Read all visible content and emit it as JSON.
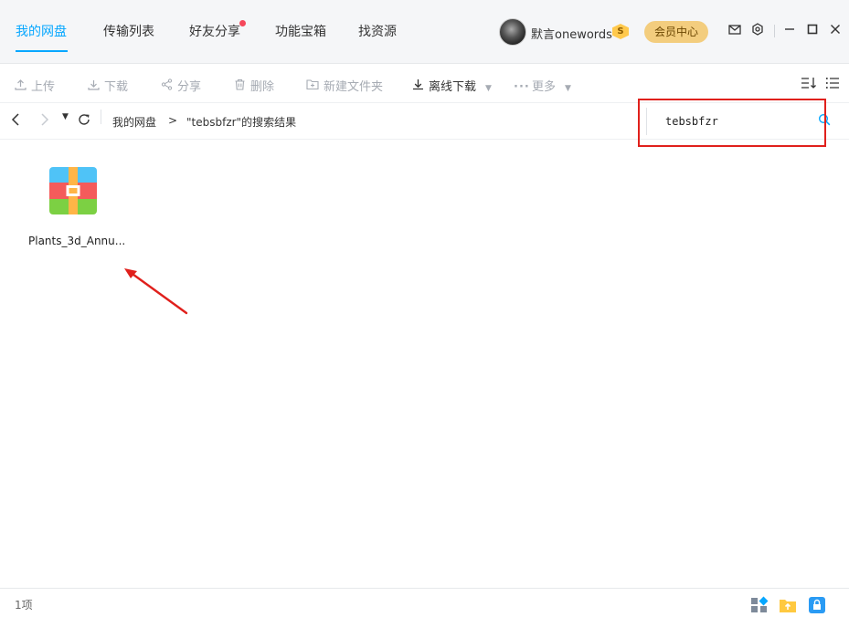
{
  "nav": {
    "tabs": [
      "我的网盘",
      "传输列表",
      "好友分享",
      "功能宝箱",
      "找资源"
    ],
    "active_index": 0,
    "user": {
      "name": "默言onewords",
      "badge": "S"
    },
    "vip_button": "会员中心"
  },
  "toolbar": {
    "upload": "上传",
    "download": "下载",
    "share": "分享",
    "delete": "删除",
    "new_folder": "新建文件夹",
    "offline_download": "离线下载",
    "more": "更多"
  },
  "address": {
    "crumb_root": "我的网盘",
    "crumb_sep": ">",
    "crumb_current": "\"tebsbfzr\"的搜索结果"
  },
  "search": {
    "value": "tebsbfzr"
  },
  "files": [
    {
      "name": "Plants_3d_Annu...",
      "type": "archive"
    }
  ],
  "status": {
    "count": "1项"
  },
  "colors": {
    "accent": "#06a7ff",
    "highlight": "#e0201c",
    "vip": "#f3cd7e"
  },
  "icons": [
    "upload-icon",
    "download-icon",
    "share-icon",
    "trash-icon",
    "new-folder-icon",
    "more-icon",
    "sort-icon",
    "list-view-icon",
    "back-icon",
    "forward-icon",
    "refresh-icon",
    "search-icon",
    "mail-icon",
    "settings-icon",
    "minimize-icon",
    "maximize-icon",
    "close-icon"
  ]
}
